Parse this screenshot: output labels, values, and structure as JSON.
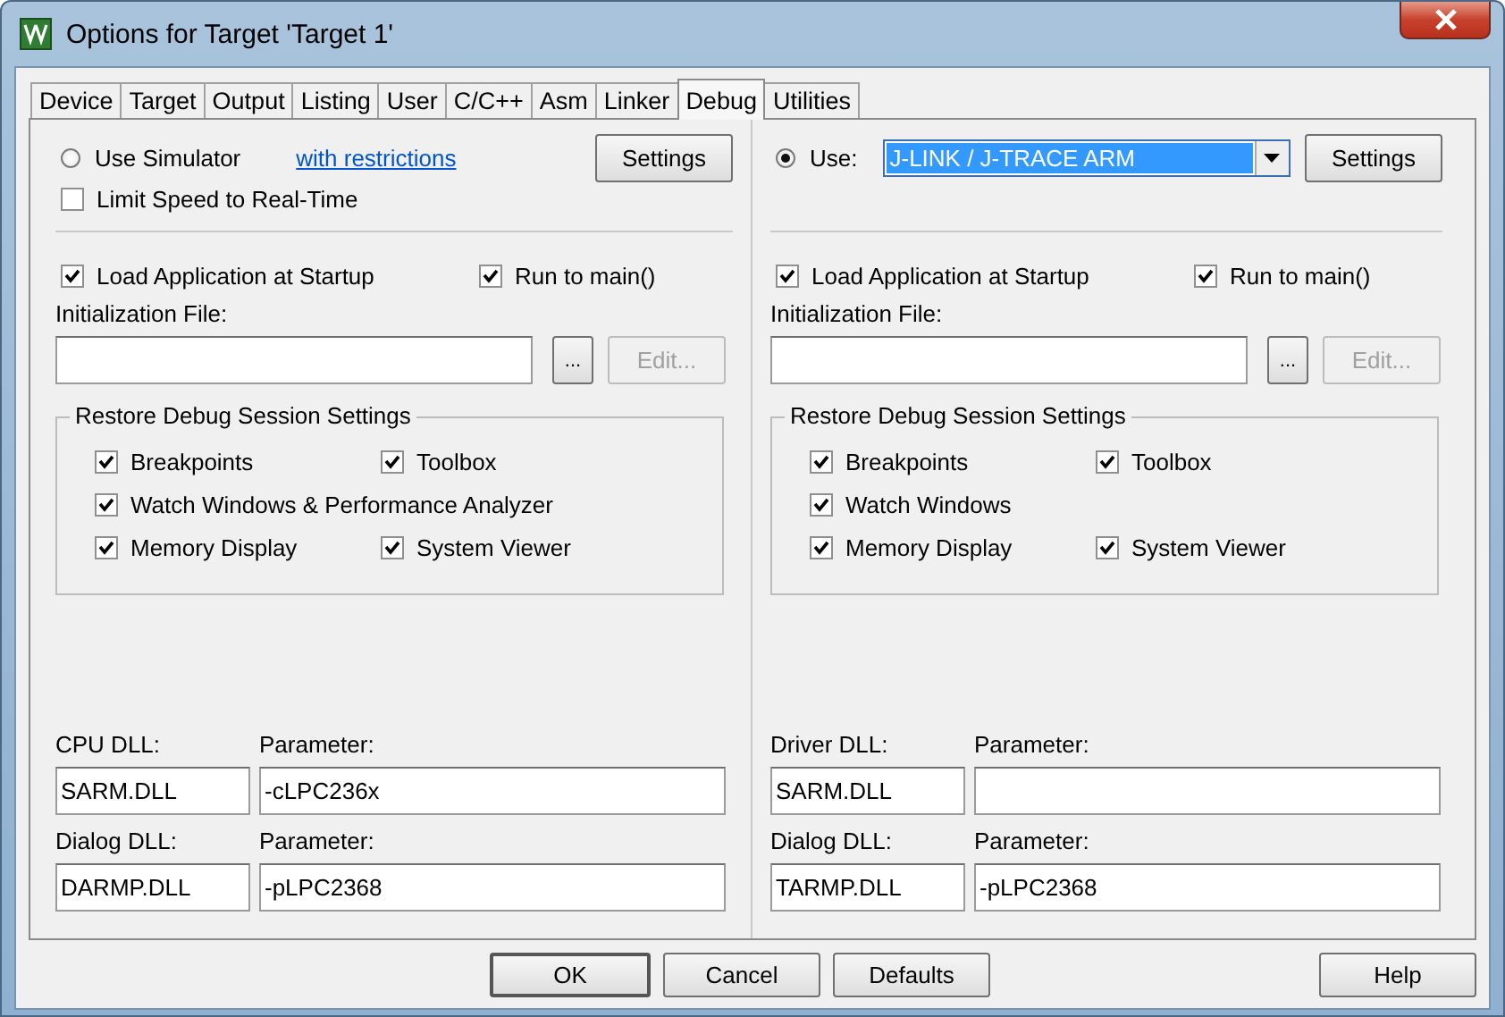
{
  "window": {
    "title": "Options for Target 'Target 1'"
  },
  "tabs": [
    {
      "label": "Device",
      "selected": false
    },
    {
      "label": "Target",
      "selected": false
    },
    {
      "label": "Output",
      "selected": false
    },
    {
      "label": "Listing",
      "selected": false
    },
    {
      "label": "User",
      "selected": false
    },
    {
      "label": "C/C++",
      "selected": false
    },
    {
      "label": "Asm",
      "selected": false
    },
    {
      "label": "Linker",
      "selected": false
    },
    {
      "label": "Debug",
      "selected": true
    },
    {
      "label": "Utilities",
      "selected": false
    }
  ],
  "panes": [
    {
      "radio": {
        "label": "Use Simulator",
        "selected": false
      },
      "link": "with restrictions",
      "settings_button": "Settings",
      "limit_speed": {
        "label": "Limit Speed to Real-Time",
        "checked": false
      },
      "load_app": {
        "label": "Load Application at Startup",
        "checked": true
      },
      "run_to_main": {
        "label": "Run to main()",
        "checked": true
      },
      "init_file": {
        "label": "Initialization File:",
        "browse_button": "...",
        "edit_button": {
          "label": "Edit...",
          "disabled": true
        }
      },
      "restore_group": {
        "title": "Restore Debug Session Settings",
        "rows": [
          [
            {
              "label": "Breakpoints",
              "checked": true
            },
            {
              "label": "Toolbox",
              "checked": true
            }
          ],
          [
            {
              "label": "Watch Windows & Performance Analyzer",
              "checked": true
            }
          ],
          [
            {
              "label": "Memory Display",
              "checked": true
            },
            {
              "label": "System Viewer",
              "checked": true
            }
          ]
        ]
      },
      "dlls": [
        {
          "label": "CPU DLL:",
          "value": "SARM.DLL",
          "param_label": "Parameter:",
          "param_value": "-cLPC236x"
        },
        {
          "label": "Dialog DLL:",
          "value": "DARMP.DLL",
          "param_label": "Parameter:",
          "param_value": "-pLPC2368"
        }
      ]
    },
    {
      "radio": {
        "label": "Use:",
        "selected": true
      },
      "dropdown": {
        "value": "J-LINK / J-TRACE ARM"
      },
      "settings_button": "Settings",
      "load_app": {
        "label": "Load Application at Startup",
        "checked": true
      },
      "run_to_main": {
        "label": "Run to main()",
        "checked": true
      },
      "init_file": {
        "label": "Initialization File:",
        "browse_button": "...",
        "edit_button": {
          "label": "Edit...",
          "disabled": true
        }
      },
      "restore_group": {
        "title": "Restore Debug Session Settings",
        "rows": [
          [
            {
              "label": "Breakpoints",
              "checked": true
            },
            {
              "label": "Toolbox",
              "checked": true
            }
          ],
          [
            {
              "label": "Watch Windows",
              "checked": true
            }
          ],
          [
            {
              "label": "Memory Display",
              "checked": true
            },
            {
              "label": "System Viewer",
              "checked": true
            }
          ]
        ]
      },
      "dlls": [
        {
          "label": "Driver DLL:",
          "value": "SARM.DLL",
          "param_label": "Parameter:"
        },
        {
          "label": "Dialog DLL:",
          "value": "TARMP.DLL",
          "param_label": "Parameter:",
          "param_value": "-pLPC2368"
        }
      ]
    }
  ],
  "buttons": [
    {
      "label": "OK",
      "default": true
    },
    {
      "label": "Cancel",
      "default": false
    },
    {
      "label": "Defaults",
      "default": false
    },
    {
      "label": "Help",
      "default": false
    }
  ]
}
